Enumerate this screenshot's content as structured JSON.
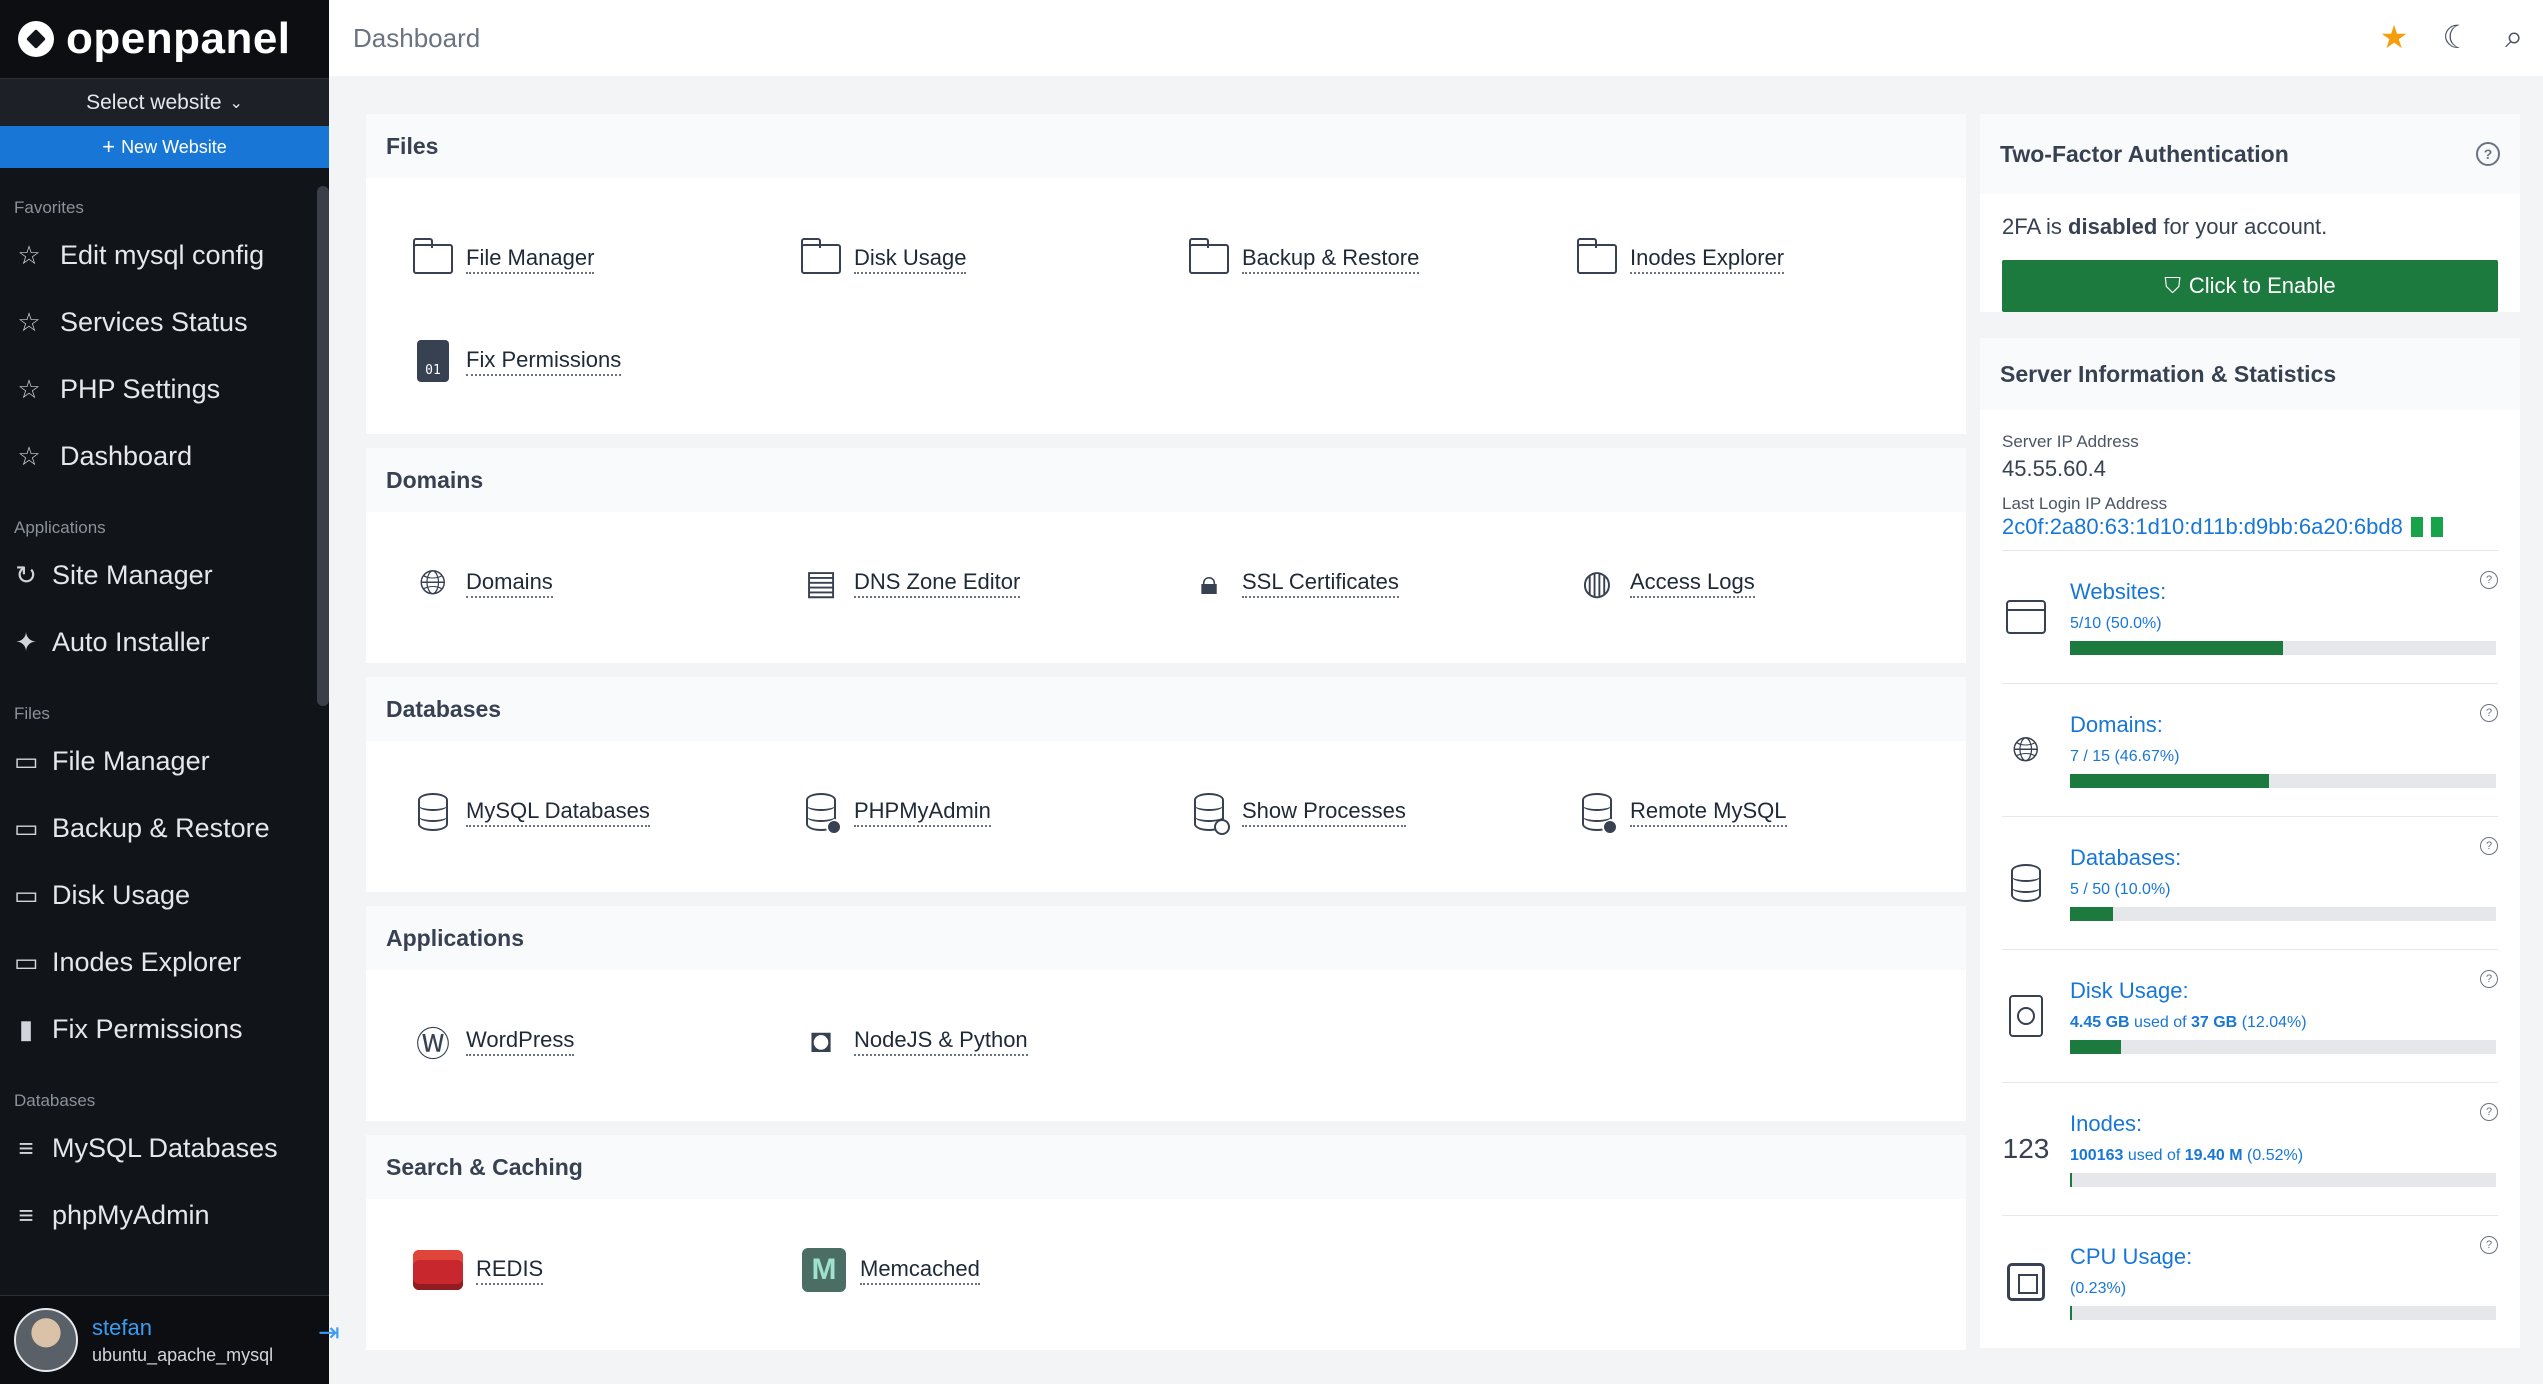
{
  "brand": {
    "name": "openpanel"
  },
  "sidebar": {
    "select_website": "Select website",
    "new_website": "New Website",
    "sections": [
      {
        "label": "Favorites",
        "items": [
          "Edit mysql config",
          "Services Status",
          "PHP Settings",
          "Dashboard"
        ]
      },
      {
        "label": "Applications",
        "items": [
          "Site Manager",
          "Auto Installer"
        ]
      },
      {
        "label": "Files",
        "items": [
          "File Manager",
          "Backup & Restore",
          "Disk Usage",
          "Inodes Explorer",
          "Fix Permissions"
        ]
      },
      {
        "label": "Databases",
        "items": [
          "MySQL Databases",
          "phpMyAdmin"
        ]
      }
    ],
    "user": {
      "name": "stefan",
      "plan": "ubuntu_apache_mysql"
    }
  },
  "topbar": {
    "title": "Dashboard"
  },
  "main": {
    "files": {
      "title": "Files",
      "items": [
        "File Manager",
        "Disk Usage",
        "Backup & Restore",
        "Inodes Explorer",
        "Fix Permissions"
      ],
      "perm_code": "01"
    },
    "domains": {
      "title": "Domains",
      "items": [
        "Domains",
        "DNS Zone Editor",
        "SSL Certificates",
        "Access Logs"
      ]
    },
    "databases": {
      "title": "Databases",
      "items": [
        "MySQL Databases",
        "PHPMyAdmin",
        "Show Processes",
        "Remote MySQL"
      ]
    },
    "applications": {
      "title": "Applications",
      "items": [
        "WordPress",
        "NodeJS & Python"
      ]
    },
    "caching": {
      "title": "Search & Caching",
      "items": [
        "REDIS",
        "Memcached"
      ],
      "memcached_letter": "M"
    }
  },
  "twofa": {
    "title": "Two-Factor Authentication",
    "text_prefix": "2FA is",
    "text_status": "disabled",
    "text_suffix": "for your account.",
    "button": "Click to Enable"
  },
  "server": {
    "title": "Server Information & Statistics",
    "ip_label": "Server IP Address",
    "ip": "45.55.60.4",
    "last_login_label": "Last Login IP Address",
    "last_login_ip": "2c0f:2a80:63:1d10:d11b:d9bb:6a20:6bd8",
    "stats": [
      {
        "name": "Websites:",
        "value": "5/10 (50.0%)",
        "fraction": 0.5
      },
      {
        "name": "Domains:",
        "value": "7 / 15 (46.67%)",
        "fraction": 0.4667
      },
      {
        "name": "Databases:",
        "value": "5 / 50 (10.0%)",
        "fraction": 0.1
      },
      {
        "name": "Disk Usage:",
        "used": "4.45 GB",
        "used_of": "used of",
        "total": "37 GB",
        "pct": "(12.04%)",
        "fraction": 0.1204
      },
      {
        "name": "Inodes:",
        "used": "100163",
        "used_of": "used of",
        "total": "19.40 M",
        "pct": "(0.52%)",
        "fraction": 0.0052,
        "icon_text": "123"
      },
      {
        "name": "CPU Usage:",
        "value": "(0.23%)",
        "fraction": 0.0023
      }
    ]
  }
}
